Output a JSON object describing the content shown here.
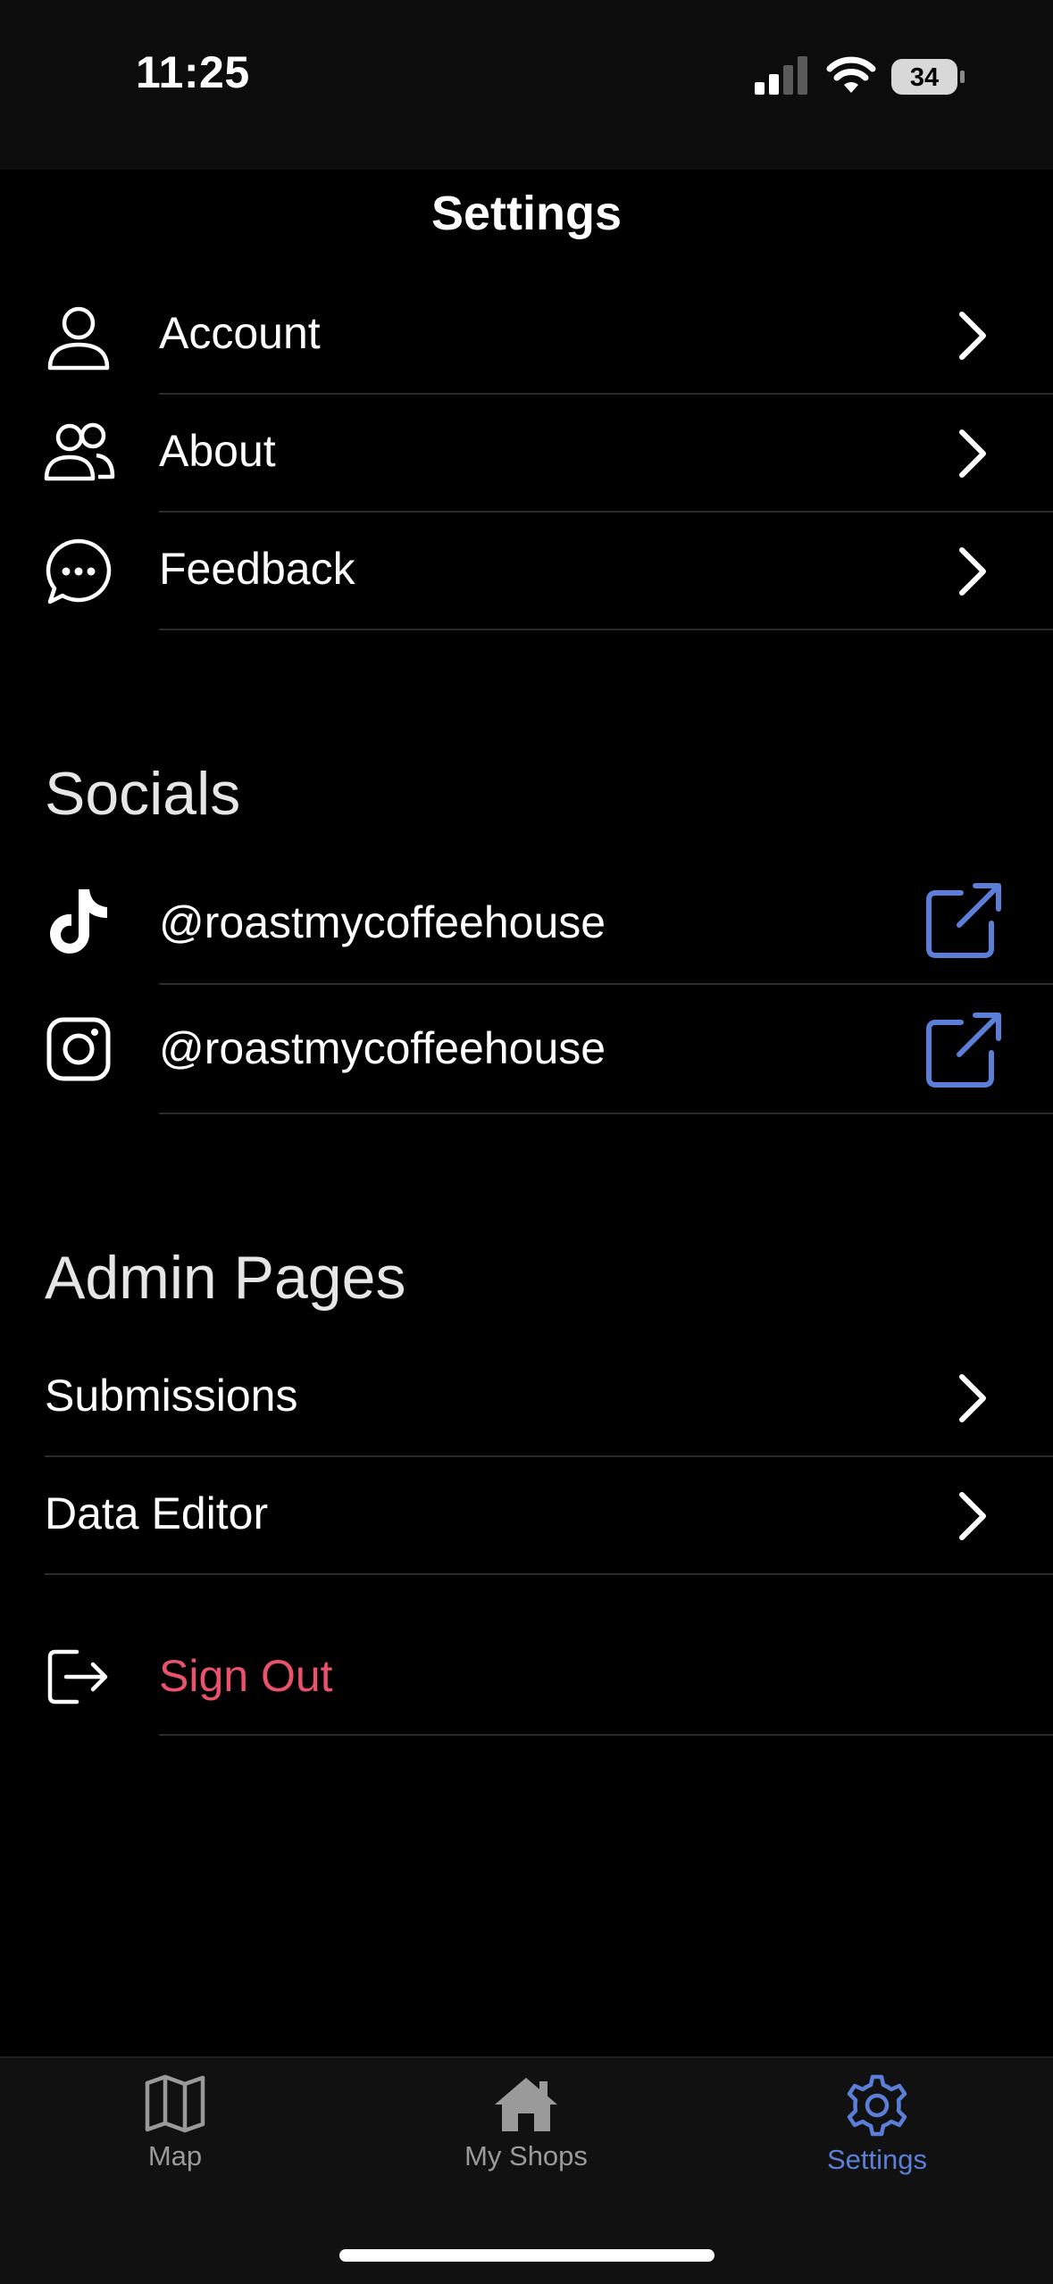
{
  "status_bar": {
    "time": "11:25",
    "battery": "34"
  },
  "header": {
    "title": "Settings"
  },
  "general_items": [
    {
      "label": "Account",
      "icon": "person-icon"
    },
    {
      "label": "About",
      "icon": "people-icon"
    },
    {
      "label": "Feedback",
      "icon": "chat-bubble-icon"
    }
  ],
  "socials": {
    "title": "Socials",
    "items": [
      {
        "label": "@roastmycoffeehouse",
        "icon": "tiktok-icon"
      },
      {
        "label": "@roastmycoffeehouse",
        "icon": "instagram-icon"
      }
    ]
  },
  "admin": {
    "title": "Admin Pages",
    "items": [
      {
        "label": "Submissions"
      },
      {
        "label": "Data Editor"
      }
    ]
  },
  "sign_out": {
    "label": "Sign Out",
    "icon": "sign-out-icon"
  },
  "tabbar": {
    "tabs": [
      {
        "label": "Map",
        "icon": "map-icon"
      },
      {
        "label": "My Shops",
        "icon": "house-icon"
      },
      {
        "label": "Settings",
        "icon": "gear-icon"
      }
    ]
  },
  "colors": {
    "accent": "#5b7fd8",
    "destructive": "#e8526a",
    "background": "#000000",
    "inactive_tab": "#9a9a9a"
  }
}
